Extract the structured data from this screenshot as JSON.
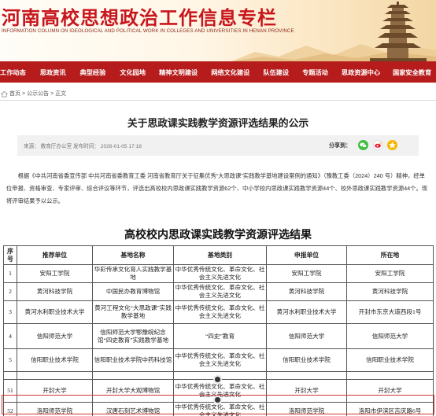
{
  "banner": {
    "title": "河南高校思想政治工作信息专栏",
    "subtitle": "INFORMATION COLUMN ON IDEOLOGICAL AND POLITICAL WORK IN COLLEGES AND UNIVERSITIES IN HENAN PROVINCE"
  },
  "nav": {
    "items": [
      "工作动态",
      "思政资讯",
      "典型经验",
      "文化园地",
      "精神文明建设",
      "网络文化建设",
      "队伍建设",
      "专题活动",
      "思政资源中心",
      "国家安全教育"
    ]
  },
  "breadcrumb": {
    "home": "首页",
    "sep": ">",
    "section": "公示公告",
    "current": "正文"
  },
  "article": {
    "title": "关于思政课实践教学资源评选结果的公示",
    "source": "来源：  教育厅办公室  发布时间：  2026-01-05 17:18",
    "share_label": "分享到：",
    "paragraph": "根据《中共河南省委宣传部 中共河南省委教育工委 河南省教育厅关于征集优秀“大思政课”实践教学基地建设案例的通知》（豫教工委（2024）240 号）精神，经单位申报、资格审查、专家评审、综合评议等环节，评选出高校校内思政课实践教学资源62个、中小学校内思政课实践教学资源44个、校外思政课实践教学资源44个。现将评审结果予以公示。"
  },
  "table": {
    "title": "高校校内思政课实践教学资源评选结果",
    "headers": [
      "序号",
      "推荐单位",
      "基地名称",
      "基地类别",
      "申报单位",
      "所在地"
    ],
    "rows": [
      [
        "1",
        "安阳工学院",
        "华彩传承文化育人实践教学基地",
        "中华优秀传统文化、革命文化、社会主义先进文化",
        "安阳工学院",
        "安阳工学院"
      ],
      [
        "2",
        "黄河科技学院",
        "中国民办教育博物馆",
        "中华优秀传统文化、革命文化、社会主义先进文化",
        "黄河科技学院",
        "黄河科技学院"
      ],
      [
        "3",
        "黄河水利职业技术大学",
        "黄河工程文化“大思政课”实践教学基地",
        "中华优秀传统文化、革命文化、社会主义先进文化",
        "黄河水利职业技术大学",
        "开封市东京大道西段1号"
      ],
      [
        "4",
        "信阳师范大学",
        "信阳师范大学鄂豫皖纪念馆“四史教育”实践教学基地",
        "“四史”教育",
        "信阳师范大学",
        "信阳师范大学"
      ],
      [
        "5",
        "信阳职业技术学院",
        "信阳职业技术学院中药科技馆",
        "中华优秀传统文化、革命文化、社会主义先进文化",
        "信阳职业技术学院",
        "信阳职业技术学院"
      ],
      [
        "51",
        "开封大学",
        "开封大学大观博物馆",
        "中华优秀传统文化、革命文化、社会主义先进文化",
        "开封大学",
        "开封大学"
      ],
      [
        "52",
        "洛阳师范学院",
        "汉唐石刻艺术博物馆",
        "中华优秀传统文化、革命文化、社会主义先进文化",
        "洛阳师范学院",
        "洛阳市伊滨区吉庆路6号"
      ]
    ]
  },
  "colors": {
    "brand_red": "#b71c1c",
    "title_red": "#c8161d",
    "highlight": "#d23333"
  },
  "icons": [
    "home-icon",
    "wechat-icon",
    "weibo-icon",
    "qzone-icon"
  ]
}
